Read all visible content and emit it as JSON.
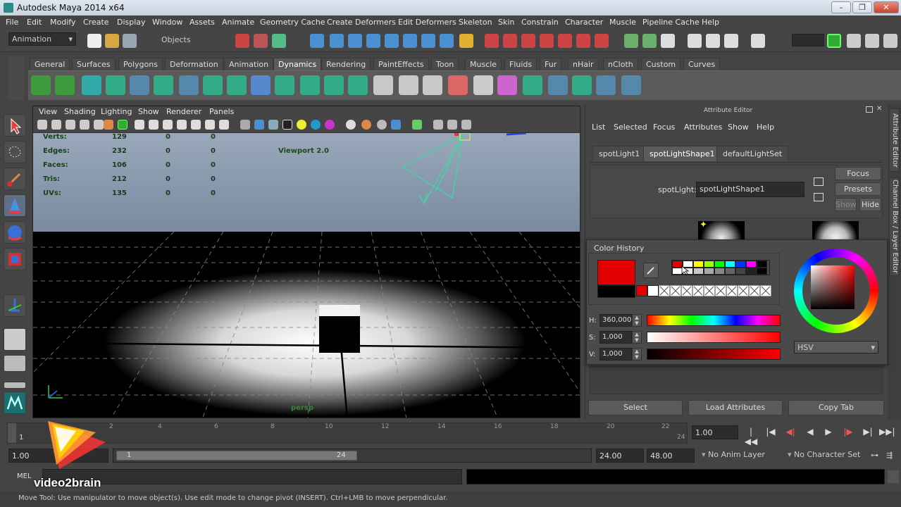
{
  "window": {
    "title": "Autodesk Maya 2014 x64",
    "buttons": [
      "–",
      "❐",
      "✕"
    ]
  },
  "menubar": [
    "File",
    "Edit",
    "Modify",
    "Create",
    "Display",
    "Window",
    "Assets",
    "Animate",
    "Geometry Cache",
    "Create Deformers",
    "Edit Deformers",
    "Skeleton",
    "Skin",
    "Constrain",
    "Character",
    "Muscle",
    "Pipeline Cache",
    "Help"
  ],
  "statusline": {
    "mode": "Animation",
    "selection_mode": "Objects"
  },
  "shelf": {
    "tabs": [
      "General",
      "Surfaces",
      "Polygons",
      "Deformation",
      "Animation",
      "Dynamics",
      "Rendering",
      "PaintEffects",
      "Toon",
      "Muscle",
      "Fluids",
      "Fur",
      "nHair",
      "nCloth",
      "Custom",
      "Curves"
    ],
    "active_tab": "Dynamics"
  },
  "viewport": {
    "menu": [
      "View",
      "Shading",
      "Lighting",
      "Show",
      "Renderer",
      "Panels"
    ],
    "hud": {
      "rows": [
        {
          "label": "Verts:",
          "v1": "129",
          "v2": "0",
          "v3": "0"
        },
        {
          "label": "Edges:",
          "v1": "232",
          "v2": "0",
          "v3": "0"
        },
        {
          "label": "Faces:",
          "v1": "106",
          "v2": "0",
          "v3": "0"
        },
        {
          "label": "Tris:",
          "v1": "212",
          "v2": "0",
          "v3": "0"
        },
        {
          "label": "UVs:",
          "v1": "135",
          "v2": "0",
          "v3": "0"
        }
      ],
      "renderer": "Viewport 2.0",
      "camera": "persp"
    }
  },
  "attribute_editor": {
    "title": "Attribute Editor",
    "menu": [
      "List",
      "Selected",
      "Focus",
      "Attributes",
      "Show",
      "Help"
    ],
    "tabs": [
      "spotLight1",
      "spotLightShape1",
      "defaultLightSet"
    ],
    "active_tab": "spotLightShape1",
    "node_label": "spotLight:",
    "node_value": "spotLightShape1",
    "side_buttons": {
      "focus": "Focus",
      "presets": "Presets",
      "show": "Show",
      "hide": "Hide"
    },
    "bottom_buttons": {
      "select": "Select",
      "load": "Load Attributes",
      "copy": "Copy Tab"
    },
    "side_tabs": [
      "Attribute Editor",
      "Channel Box / Layer Editor"
    ]
  },
  "color_picker": {
    "title": "Color History",
    "current_color": "#e50000",
    "h_label": "H:",
    "h_value": "360,000",
    "s_label": "S:",
    "s_value": "1,000",
    "v_label": "V:",
    "v_value": "1,000",
    "mode": "HSV",
    "history_colors": [
      "#e50000",
      "#ffffff",
      "#ffff00",
      "#00ff00",
      "#00ffff",
      "#0033ff",
      "#ff00ff",
      "#000000"
    ]
  },
  "timeline": {
    "ticks": [
      "1",
      "2",
      "4",
      "6",
      "8",
      "10",
      "12",
      "14",
      "16",
      "18",
      "20",
      "22",
      "24"
    ],
    "current_frame": "1.00",
    "playback_buttons": [
      "|◀◀",
      "|◀",
      "◀|",
      "◀",
      "▶",
      "|▶",
      "▶|",
      "▶▶|"
    ]
  },
  "range": {
    "start": "1.00",
    "range_start": "1",
    "range_end": "24",
    "end": "24.00",
    "max": "48.00",
    "anim_layer": "No Anim Layer",
    "character_set": "No Character Set"
  },
  "cmdline": {
    "label": "MEL"
  },
  "watermark": "video2brain",
  "helpline": "Move Tool: Use manipulator to move object(s). Use edit mode to change pivot (INSERT).  Ctrl+LMB to move perpendicular."
}
